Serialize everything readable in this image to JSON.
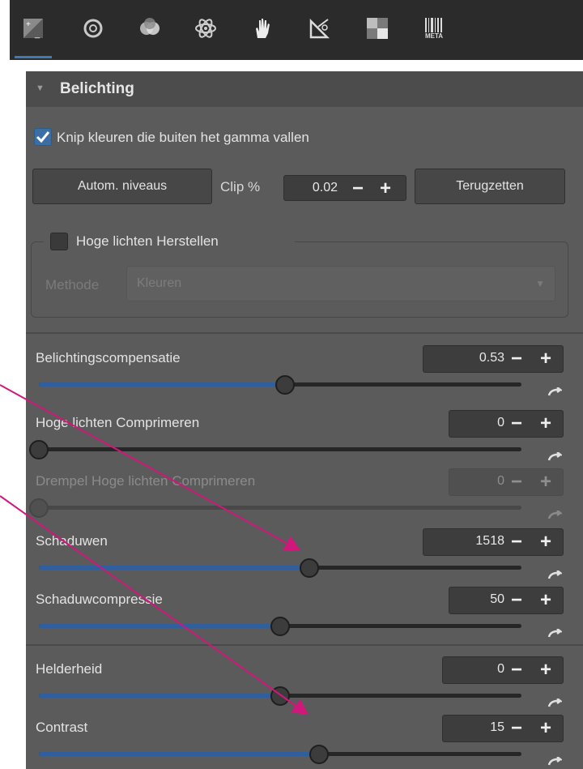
{
  "toolbar": {
    "tabs": [
      {
        "icon": "exposure-icon",
        "active": true
      },
      {
        "icon": "detail-icon"
      },
      {
        "icon": "color-icon"
      },
      {
        "icon": "advanced-icon"
      },
      {
        "icon": "local-adjust-icon"
      },
      {
        "icon": "transform-icon"
      },
      {
        "icon": "raw-icon"
      },
      {
        "icon": "meta-icon",
        "label": "META"
      }
    ]
  },
  "panel": {
    "title": "Belichting",
    "clip_checkbox": {
      "label": "Knip kleuren die buiten het gamma vallen",
      "checked": true
    },
    "auto_levels_button": "Autom. niveaus",
    "clip_label": "Clip %",
    "clip_value": "0.02",
    "reset_button": "Terugzetten",
    "highlight_recovery": {
      "label": "Hoge lichten Herstellen",
      "checked": false,
      "method_label": "Methode",
      "method_value": "Kleuren"
    },
    "sliders": [
      {
        "label": "Belichtingscompensatie",
        "value": "0.53",
        "position": 0.51,
        "enabled": true
      },
      {
        "label": "Hoge lichten Comprimeren",
        "value": "0",
        "position": 0.0,
        "enabled": true
      },
      {
        "label": "Drempel Hoge lichten Comprimeren",
        "value": "0",
        "position": 0.0,
        "enabled": false
      },
      {
        "label": "Schaduwen",
        "value": "1518",
        "position": 0.56,
        "enabled": true
      },
      {
        "label": "Schaduwcompressie",
        "value": "50",
        "position": 0.5,
        "enabled": true
      },
      {
        "label": "Helderheid",
        "value": "0",
        "position": 0.5,
        "enabled": true
      },
      {
        "label": "Contrast",
        "value": "15",
        "position": 0.58,
        "enabled": true
      }
    ]
  },
  "colors": {
    "accent": "#3a6ea5",
    "slider_fill": "#2f5f9e",
    "annotation_arrow": "#d0177a"
  }
}
